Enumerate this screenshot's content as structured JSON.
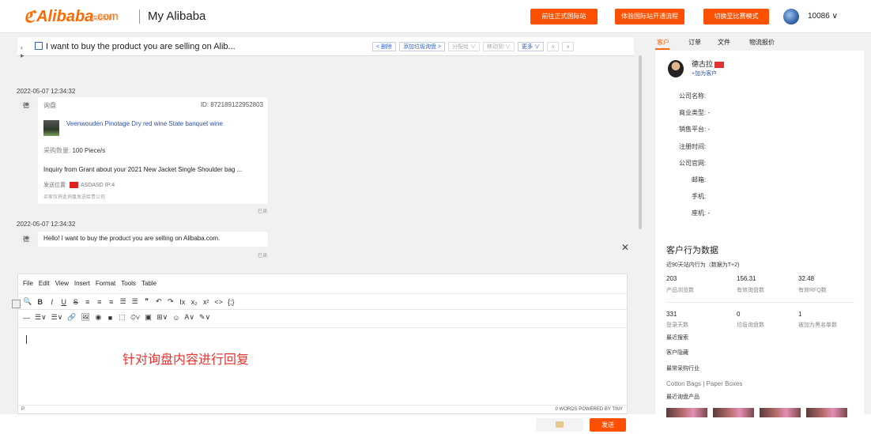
{
  "header": {
    "logo_text": "Alibaba",
    "logo_com": ".com",
    "logo_sub": "供应实训",
    "section_title": "My Alibaba",
    "buttons": [
      "前往正式国际站",
      "体验国际站开通流程",
      "切换至比赛模式"
    ],
    "user_id": "10086 ∨",
    "accent": "#ff5000"
  },
  "thread": {
    "subject": "I want to buy the product you are selling on Alib...",
    "actions": [
      "< 删除",
      "添加垃圾询盘 >",
      "分配给 ∨",
      "移动到 ∨",
      "更多 ∨",
      "∧",
      "∨"
    ],
    "messages": [
      {
        "timestamp": "2022-05-07 12:34:32",
        "avatar": "德",
        "type_label": "询盘",
        "inquiry_id": "ID: 872189122952803",
        "product_title": "Veenwouden Pinotage Dry red wine State banquet wine",
        "qty_key": "采购数量:",
        "qty_val": "100 Piece/s",
        "inquiry_text": "Inquiry from Grant about your 2021 New Jacket Single Shoulder bag ...",
        "location_key": "发送位置:",
        "location_val": "ASDASD  IP:4",
        "note": "买家仅将此询盘发送给贵公司",
        "status": "已读"
      },
      {
        "timestamp": "2022-05-07 12:34:32",
        "avatar": "德",
        "text": "Hello!  I want to buy the product you are selling on Alibaba.com.",
        "status": "已读"
      }
    ]
  },
  "editor": {
    "menu": [
      "File",
      "Edit",
      "View",
      "Insert",
      "Format",
      "Tools",
      "Table"
    ],
    "toolbar1": [
      "🔍",
      "B",
      "I",
      "U",
      "S",
      "≡",
      "≡",
      "≡",
      "☰",
      "☰",
      "❞",
      "↶",
      "↷",
      "Ix",
      "x₂",
      "x²",
      "<>",
      "{;}"
    ],
    "toolbar2": [
      "—",
      "☰∨",
      "☰∨",
      "🔗",
      "🖼",
      "◉",
      "■",
      "⬚",
      "⏲∨",
      "▣",
      "⊞∨",
      "☺",
      "A∨",
      "✎∨"
    ],
    "hint": "针对询盘内容进行回复",
    "status_left": "P",
    "status_right": "0 WORDS  POWERED BY TINY",
    "close": "✕"
  },
  "footer": {
    "send_label": "发送"
  },
  "sidebar": {
    "tabs": [
      "客户",
      "订单",
      "文件",
      "物流报价"
    ],
    "customer": {
      "name": "德古拉",
      "add_label": "+加为客户",
      "fields": [
        "公司名称:",
        "商业类型: -",
        "销售平台: -",
        "注册时间:",
        "公司官网:",
        "邮箱:",
        "手机:",
        "座机: -"
      ]
    },
    "stats": {
      "title": "客户行为数据",
      "subtitle": "近90天站内行为（数据为T+2)",
      "row1": [
        {
          "num": "203",
          "label": "产品浏览数"
        },
        {
          "num": "156.31",
          "label": "有效询盘数"
        },
        {
          "num": "32.48",
          "label": "有效RFQ数"
        }
      ],
      "row2": [
        {
          "num": "331",
          "label": "登录天数"
        },
        {
          "num": "0",
          "label": "垃圾询盘数"
        },
        {
          "num": "1",
          "label": "被加为黑名单数"
        }
      ],
      "sections": [
        "最近搜索",
        "客户隐藏",
        "最常采购行业",
        "最近询盘产品"
      ],
      "industries": "Cotton Bags  |  Paper Boxes"
    }
  }
}
